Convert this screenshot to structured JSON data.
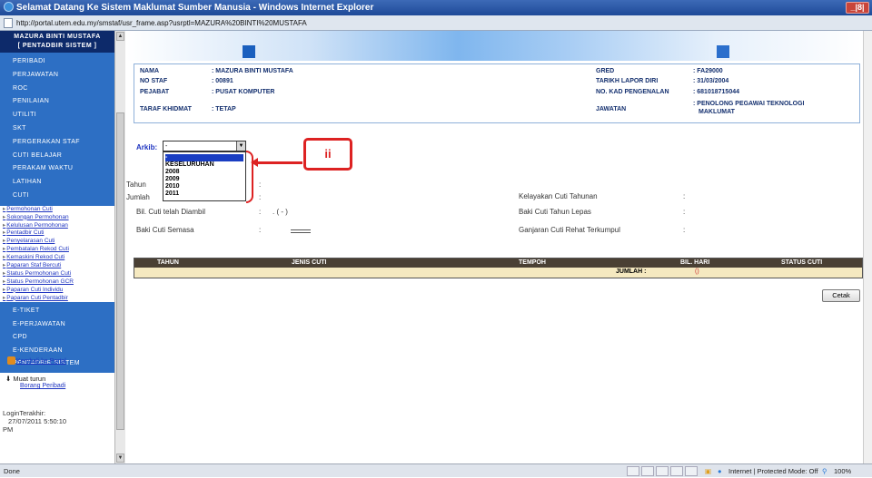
{
  "window": {
    "title": "Selamat Datang Ke Sistem Maklumat Sumber Manusia - Windows Internet Explorer",
    "url": "http://portal.utem.edu.my/smstaf/usr_frame.asp?usrptl=MAZURA%20BINTI%20MUSTAFA",
    "controls": "_|8|"
  },
  "sidebar": {
    "header_line1": "MAZURA BINTI MUSTAFA",
    "header_line2": "[ PENTADBIR SISTEM ]",
    "menu": [
      "PERIBADI",
      "PERJAWATAN",
      "ROC",
      "PENILAIAN",
      "UTILITI",
      "SKT",
      "PERGERAKAN STAF",
      "CUTI BELAJAR",
      "PERAKAM WAKTU",
      "LATIHAN",
      "CUTI"
    ],
    "submenu": [
      "Permohonan Cuti",
      "Sokongan Permohonan",
      "Kelulusan Permohonan",
      "Pentadbir Cuti",
      "Penyelarasan Cuti",
      "Pembatalan Rekod Cuti",
      "Kemaskini Rekod Cuti",
      "Paparan Staf Bercuti",
      "Status Permohonan Cuti",
      "Status Permohonan GCR",
      "Paparan Cuti Individu",
      "Paparan Cuti Pentadbir"
    ],
    "menu2": [
      "E-TIKET",
      "E-PERJAWATAN",
      "CPD",
      "E-KENDERAAN",
      "PENTADBIR SISTEM"
    ],
    "portal_link": "Kembali ke Portal",
    "download_label": "Muat turun",
    "download_link": "Borang Peribadi",
    "last_login_label": "LoginTerakhir:",
    "last_login_value": "27/07/2011 5:50:10",
    "last_login_ampm": "PM"
  },
  "profile": {
    "nama_label": "NAMA",
    "nama": ": MAZURA BINTI MUSTAFA",
    "nostaf_label": "NO STAF",
    "nostaf": ": 00891",
    "pejabat_label": "PEJABAT",
    "pejabat": ": PUSAT KOMPUTER",
    "taraf_label": "TARAF KHIDMAT",
    "taraf": ": TETAP",
    "gred_label": "GRED",
    "gred": ": FA29000",
    "tarikh_label": "TARIKH LAPOR DIRI",
    "tarikh": ": 31/03/2004",
    "kp_label": "NO. KAD PENGENALAN",
    "kp": ": 681018715044",
    "jawatan_label": "JAWATAN",
    "jawatan_line1": ": PENOLONG PEGAWAI TEKNOLOGI",
    "jawatan_line2": "MAKLUMAT"
  },
  "archive": {
    "label": "Arkib:",
    "selected": "-",
    "options": [
      "-",
      "KESELURUHAN",
      "2008",
      "2009",
      "2010",
      "2011"
    ],
    "callout": "ii"
  },
  "leave": {
    "tahun_label": "Tahun",
    "jumlah_label": "Jumlah",
    "colon": ":",
    "bil_label": "Bil. Cuti telah Diambil",
    "bil_value": ". ( - )",
    "baki_semasa_label": "Baki Cuti Semasa",
    "kelayakan_label": "Kelayakan Cuti Tahunan",
    "baki_lepas_label": "Baki Cuti Tahun Lepas",
    "ganjaran_label": "Ganjaran Cuti Rehat Terkumpul"
  },
  "table": {
    "headers": [
      "TAHUN",
      "JENIS CUTI",
      "TEMPOH",
      "BIL. HARI",
      "STATUS CUTI"
    ],
    "jumlah_label": "JUMLAH :",
    "jumlah_value": "()"
  },
  "cetak_label": "Cetak",
  "status": {
    "left": "Done",
    "zone": "Internet | Protected Mode: Off",
    "zoom": "100%"
  }
}
